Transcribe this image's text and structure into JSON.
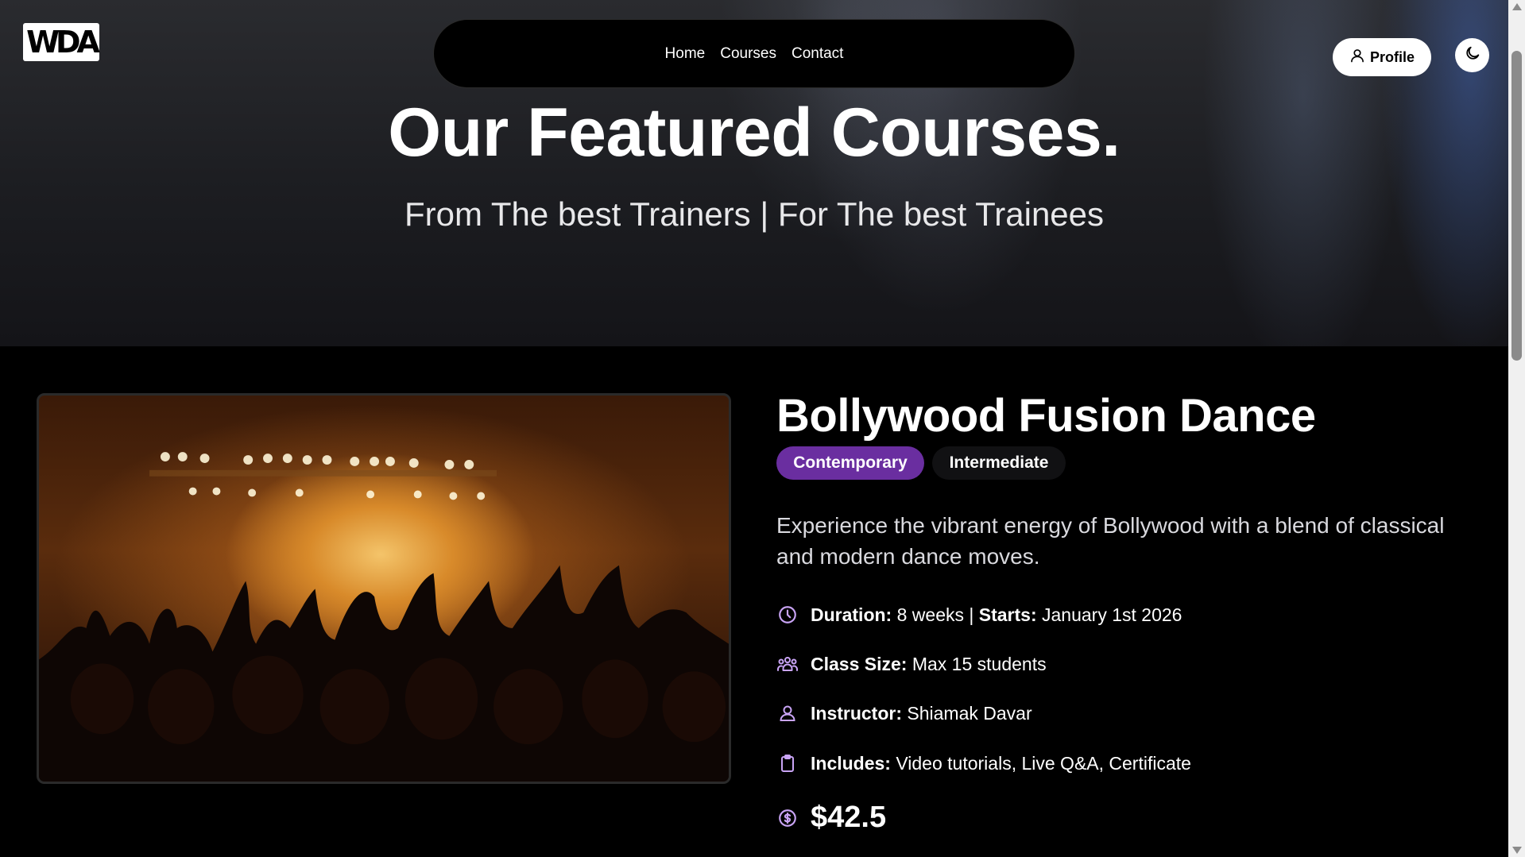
{
  "brand": {
    "logo_text": "WDA"
  },
  "nav": {
    "items": [
      {
        "label": "Home"
      },
      {
        "label": "Courses"
      },
      {
        "label": "Contact"
      }
    ]
  },
  "header": {
    "profile_label": "Profile",
    "theme_icon": "moon-icon"
  },
  "hero": {
    "title": "Our Featured Courses.",
    "subtitle": "From The best Trainers | For The best Trainees"
  },
  "course": {
    "title": "Bollywood Fusion Dance",
    "style_badge": "Contemporary",
    "level_badge": "Intermediate",
    "description": "Experience the vibrant energy of Bollywood with a blend of classical and modern dance moves.",
    "duration_label": "Duration:",
    "duration_value": "8 weeks",
    "separator": "|",
    "starts_label": "Starts:",
    "starts_value": "January 1st 2026",
    "class_size_label": "Class Size:",
    "class_size_value": "Max 15 students",
    "instructor_label": "Instructor:",
    "instructor_value": "Shiamak Davar",
    "includes_label": "Includes:",
    "includes_value": "Video tutorials, Live Q&A, Certificate",
    "price": "$42.5",
    "image_icon": "concert-crowd-image"
  },
  "colors": {
    "accent": "#6a2ea0",
    "icon_accent": "#c9a4f5",
    "background": "#000000"
  }
}
